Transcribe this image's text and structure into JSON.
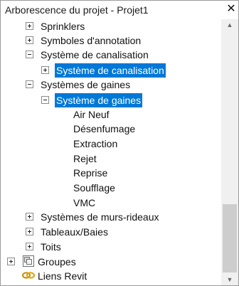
{
  "window": {
    "title": "Arborescence du projet - Projet1",
    "close_glyph": "✕"
  },
  "tree": {
    "rows": [
      {
        "label": "Sprinklers",
        "expander": "plus"
      },
      {
        "label": "Symboles d'annotation",
        "expander": "plus"
      },
      {
        "label": "Système de canalisation",
        "expander": "minus"
      },
      {
        "label": "Système de canalisation",
        "expander": "plus",
        "selected": true
      },
      {
        "label": "Systèmes de gaines",
        "expander": "minus"
      },
      {
        "label": "Système de gaines",
        "expander": "minus",
        "selected": true
      },
      {
        "label": "Air Neuf"
      },
      {
        "label": "Désenfumage"
      },
      {
        "label": "Extraction"
      },
      {
        "label": "Rejet"
      },
      {
        "label": "Reprise"
      },
      {
        "label": "Soufflage"
      },
      {
        "label": "VMC"
      },
      {
        "label": "Systèmes de murs-rideaux",
        "expander": "plus"
      },
      {
        "label": "Tableaux/Baies",
        "expander": "plus"
      },
      {
        "label": "Toits",
        "expander": "plus"
      },
      {
        "label": "Groupes",
        "expander": "plus",
        "icon": "groups-icon"
      },
      {
        "label": "Liens Revit",
        "icon": "revit-links-icon"
      }
    ]
  },
  "scrollbar": {
    "up_glyph": "▲",
    "down_glyph": "▼"
  },
  "colors": {
    "selection": "#0078d7",
    "selection_text": "#ffffff"
  }
}
